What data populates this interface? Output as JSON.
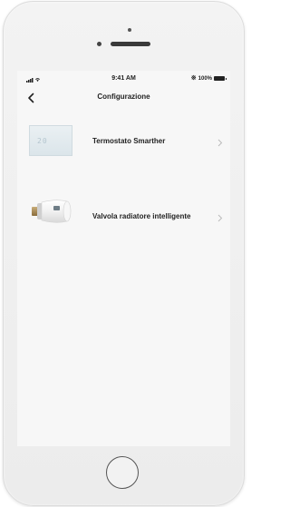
{
  "status_bar": {
    "time": "9:41 AM",
    "battery_text": "100%",
    "signal_icon": "signal-wifi-icon",
    "bluetooth_icon": "bluetooth-icon",
    "battery_icon": "battery-full-icon"
  },
  "nav": {
    "title": "Configurazione",
    "back_icon": "chevron-left-icon"
  },
  "items": [
    {
      "label": "Termostato Smarther",
      "thumbnail_display": "20",
      "chevron_icon": "chevron-right-icon"
    },
    {
      "label": "Valvola radiatore intelligente",
      "chevron_icon": "chevron-right-icon"
    }
  ],
  "colors": {
    "screen_bg": "#f7f7f7",
    "text": "#222222",
    "chevron": "#bbbbbb",
    "phone_body": "#ececec"
  }
}
